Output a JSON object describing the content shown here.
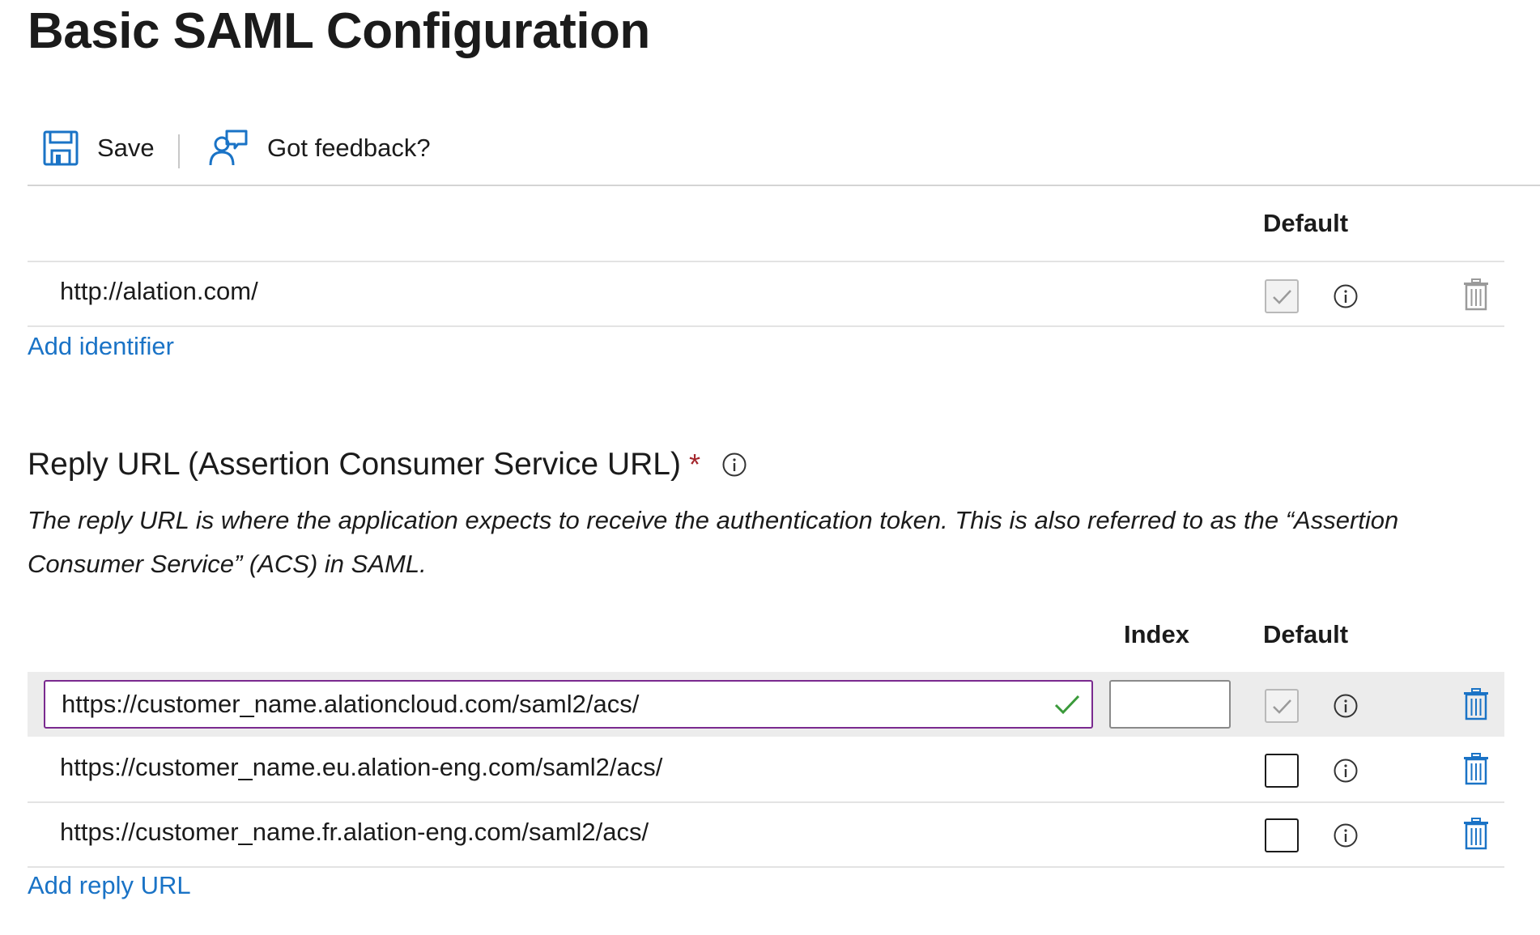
{
  "page": {
    "title": "Basic SAML Configuration"
  },
  "toolbar": {
    "save_label": "Save",
    "feedback_label": "Got feedback?"
  },
  "identifier_section": {
    "columns": {
      "default": "Default"
    },
    "rows": [
      {
        "value": "http://alation.com/",
        "default_checked": true,
        "default_disabled": true
      }
    ],
    "add_link": "Add identifier"
  },
  "reply_section": {
    "title": "Reply URL (Assertion Consumer Service URL)",
    "required_marker": "*",
    "description": "The reply URL is where the application expects to receive the authentication token. This is also referred to as the “Assertion Consumer Service” (ACS) in SAML.",
    "columns": {
      "index": "Index",
      "default": "Default"
    },
    "rows": [
      {
        "value": "https://customer_name.alationcloud.com/saml2/acs/",
        "index": "",
        "default_checked": true,
        "default_disabled": true,
        "editing": true
      },
      {
        "value": "https://customer_name.eu.alation-eng.com/saml2/acs/",
        "default_checked": false
      },
      {
        "value": "https://customer_name.fr.alation-eng.com/saml2/acs/",
        "default_checked": false
      }
    ],
    "add_link": "Add reply URL"
  },
  "colors": {
    "accent": "#1a73c6",
    "input_focus_border": "#7a2a8f",
    "valid_check": "#3a9a3a",
    "required": "#a4262c"
  }
}
